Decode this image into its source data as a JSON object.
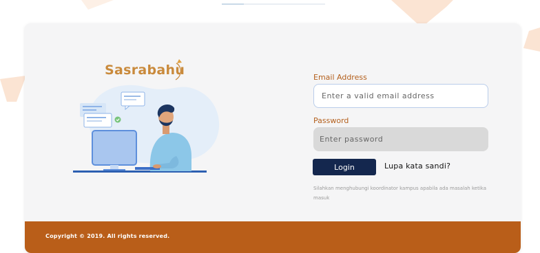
{
  "brand": {
    "name": "Sasrabahu",
    "color": "#c98a3c"
  },
  "form": {
    "email_label": "Email Address",
    "email_placeholder": "Enter a valid email address",
    "email_value": "",
    "password_label": "Password",
    "password_placeholder": "Enter password",
    "password_value": "",
    "login_label": "Login",
    "forgot_label": "Lupa kata sandi?",
    "help_text": "Silahkan menghubungi koordinator kampus apabila ada masalah ketika masuk"
  },
  "footer": {
    "copyright": "Copyright © 2019. All rights reserved.",
    "color": "#b95e19"
  },
  "colors": {
    "accent_label": "#b4601d",
    "button": "#14274e",
    "background_shapes": "#fbe6d6"
  },
  "icons": {
    "illustration": "person-at-computer-illustration",
    "check": "check-circle-icon",
    "logo_arc": "logo-arc-icon"
  }
}
